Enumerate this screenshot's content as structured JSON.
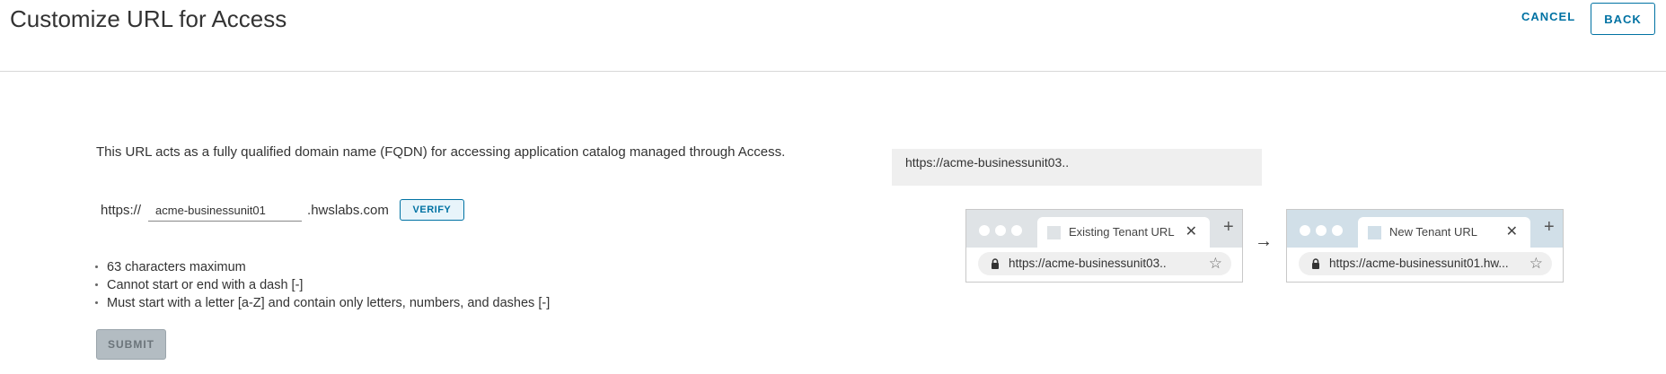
{
  "header": {
    "title": "Customize URL for Access",
    "cancel_label": "CANCEL",
    "back_label": "BACK"
  },
  "form": {
    "description": "This URL acts as a fully qualified domain name (FQDN) for accessing application catalog managed through Access.",
    "url_prefix": "https://",
    "input_value": "acme-businessunit01",
    "url_suffix": ".hwslabs.com",
    "verify_label": "VERIFY",
    "rules": [
      "63 characters maximum",
      "Cannot start or end with a dash [-]",
      "Must start with a letter [a-Z] and contain only letters, numbers, and dashes [-]"
    ],
    "submit_label": "SUBMIT"
  },
  "preview": {
    "current_url": "https://acme-businessunit03..",
    "existing_browser": {
      "tab_title": "Existing Tenant URL",
      "address": "https://acme-businessunit03.."
    },
    "new_browser": {
      "tab_title": "New Tenant URL",
      "address": "https://acme-businessunit01.hw..."
    }
  },
  "icons": {
    "arrow": "arrow-right-icon",
    "close": "close-icon",
    "plus": "plus-icon",
    "lock": "lock-icon",
    "star": "star-icon"
  },
  "colors": {
    "accent": "#0072a3",
    "submit_disabled": "#b3bcc2"
  }
}
